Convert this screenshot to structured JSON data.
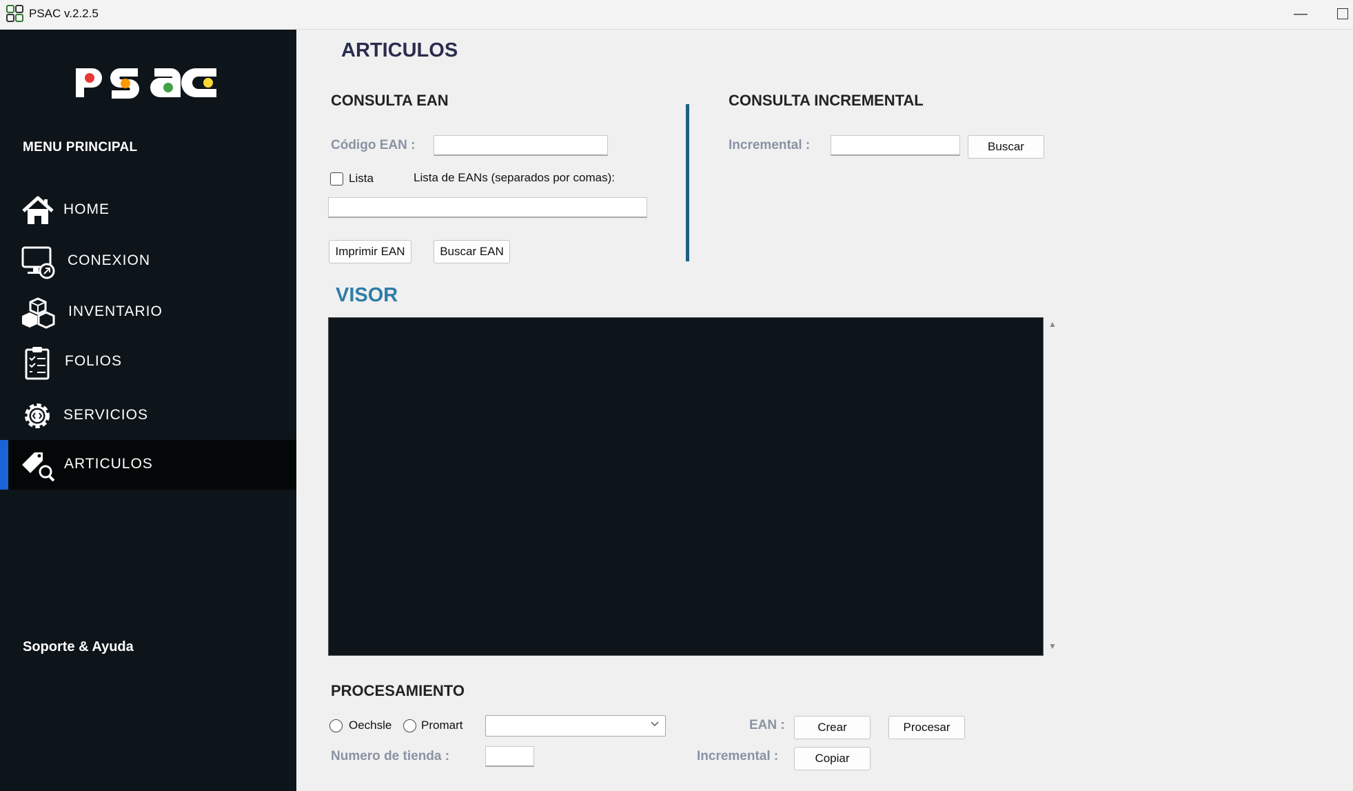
{
  "window": {
    "title": "PSAC v.2.2.5"
  },
  "sidebar": {
    "logo_text": "psac",
    "menu_title": "MENU PRINCIPAL",
    "items": [
      {
        "label": "HOME",
        "icon": "home-icon"
      },
      {
        "label": "CONEXION",
        "icon": "monitor-connection-icon"
      },
      {
        "label": "INVENTARIO",
        "icon": "boxes-icon"
      },
      {
        "label": "FOLIOS",
        "icon": "clipboard-icon"
      },
      {
        "label": "SERVICIOS",
        "icon": "gear-code-icon"
      },
      {
        "label": "ARTICULOS",
        "icon": "tag-search-icon",
        "active": true
      }
    ],
    "support": "Soporte & Ayuda",
    "active_color": "#1a63d8"
  },
  "main": {
    "title": "ARTICULOS",
    "consulta_ean": {
      "title": "CONSULTA EAN",
      "codigo_label": "Código EAN :",
      "codigo_value": "",
      "lista_label": "Lista",
      "lista_checked": false,
      "lista_eans_label": "Lista de EANs (separados por comas):",
      "lista_eans_value": "",
      "imprimir_button": "Imprimir EAN",
      "buscar_button": "Buscar EAN"
    },
    "consulta_incremental": {
      "title": "CONSULTA INCREMENTAL",
      "incremental_label": "Incremental :",
      "incremental_value": "",
      "buscar_button": "Buscar"
    },
    "visor": {
      "title": "VISOR",
      "content": ""
    },
    "procesamiento": {
      "title": "PROCESAMIENTO",
      "radio_oechsle": "Oechsle",
      "radio_promart": "Promart",
      "select_value": "",
      "tienda_label": "Numero de tienda :",
      "tienda_value": "",
      "ean_label": "EAN :",
      "crear_button": "Crear",
      "procesar_button": "Procesar",
      "incremental_label": "Incremental :",
      "copiar_button": "Copiar"
    }
  }
}
